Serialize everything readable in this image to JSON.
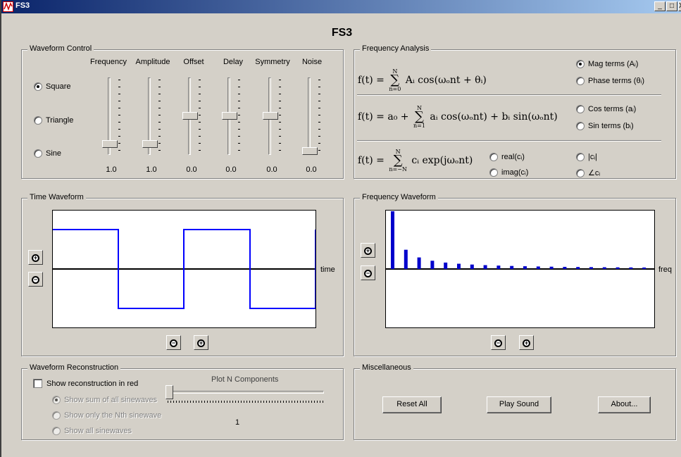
{
  "window": {
    "title": "FS3",
    "controls": [
      "_",
      "□",
      "X"
    ]
  },
  "main_title": "FS3",
  "waveform_control": {
    "label": "Waveform Control",
    "wave_types": [
      {
        "label": "Square",
        "selected": true
      },
      {
        "label": "Triangle",
        "selected": false
      },
      {
        "label": "Sine",
        "selected": false
      }
    ],
    "sliders": [
      {
        "label": "Frequency",
        "value": "1.0"
      },
      {
        "label": "Amplitude",
        "value": "1.0"
      },
      {
        "label": "Offset",
        "value": "0.0"
      },
      {
        "label": "Delay",
        "value": "0.0"
      },
      {
        "label": "Symmetry",
        "value": "0.0"
      },
      {
        "label": "Noise",
        "value": "0.0"
      }
    ]
  },
  "frequency_analysis": {
    "label": "Frequency Analysis",
    "formula1": {
      "lhs": "f(t) =",
      "sum_top": "N",
      "sum_bot": "n=0",
      "body": "Aᵢ cos(ωₒnt + θᵢ)"
    },
    "formula2": {
      "lhs": "f(t) =",
      "a0": "a₀ +",
      "sum_top": "N",
      "sum_bot": "n=1",
      "body": "aᵢ cos(ωₒnt) + bᵢ sin(ωₒnt)"
    },
    "formula3": {
      "lhs": "f(t) =",
      "sum_top": "N",
      "sum_bot": "n=−N",
      "body": "cᵢ exp(jωₒnt)"
    },
    "options": {
      "mag_terms": "Mag terms (Aᵢ)",
      "phase_terms": "Phase terms (θᵢ)",
      "cos_terms": "Cos terms (aᵢ)",
      "sin_terms": "Sin terms (bᵢ)",
      "real_c": "real(cᵢ)",
      "imag_c": "imag(cᵢ)",
      "abs_c": "|cᵢ|",
      "angle_c": "∠cᵢ"
    }
  },
  "time_waveform": {
    "label": "Time Waveform",
    "axis_label": "time",
    "color": "#0000ff"
  },
  "frequency_waveform": {
    "label": "Frequency Waveform",
    "axis_label": "freq",
    "color": "#0000cc"
  },
  "reconstruction": {
    "label": "Waveform Reconstruction",
    "show_red": "Show reconstruction in red",
    "plot_n_label": "Plot N Components",
    "n_value": "1",
    "options": [
      "Show sum of all sinewaves",
      "Show only the Nth sinewave",
      "Show all sinewaves"
    ]
  },
  "misc": {
    "label": "Miscellaneous",
    "reset": "Reset All",
    "play": "Play Sound",
    "about": "About..."
  }
}
